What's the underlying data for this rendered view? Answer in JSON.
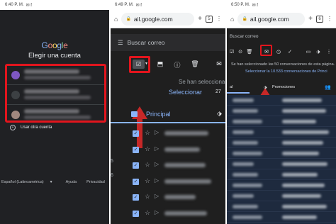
{
  "panel1": {
    "status_time": "6:40 P. M.",
    "status_icons": "✉ f",
    "logo_letters": [
      "G",
      "o",
      "o",
      "g",
      "l",
      "e"
    ],
    "logo_colors": [
      "#8ab4f8",
      "#f28b82",
      "#fdd663",
      "#8ab4f8",
      "#81c995",
      "#f28b82"
    ],
    "title": "Elegir una cuenta",
    "accounts": [
      {
        "avatar_color": "#7e57c2"
      },
      {
        "avatar_color": "#3c4043"
      },
      {
        "avatar_color": "#a1887f"
      }
    ],
    "other_account": "Usar otra cuenta",
    "footer": {
      "language": "Español (Latinoamérica)",
      "help": "Ayuda",
      "privacy": "Privacidad"
    }
  },
  "panel2": {
    "status_time": "6:49 P. M.",
    "status_icons": "✉ f",
    "url": "ail.google.com",
    "tab_count": "5",
    "search_placeholder": "Buscar correo",
    "selection_message": "Se han selecciona",
    "select_all_link": "Seleccionar",
    "side_number": "27",
    "category_label": "Principal",
    "row_count": 6,
    "edge_numbers": [
      "5",
      "6"
    ]
  },
  "panel3": {
    "status_time": "6:50 P. M.",
    "status_icons": "✉ f",
    "url": "ail.google.com",
    "tab_count": "6",
    "search_placeholder": "Buscar correo",
    "selection_message": "Se han seleccionado las 50 conversaciones de esta página.",
    "select_all_link": "Seleccionar la 10.533 conversaciones de Princi",
    "tabs": {
      "primary": "al",
      "promotions": "Promociones"
    },
    "grid_rows": 12
  }
}
